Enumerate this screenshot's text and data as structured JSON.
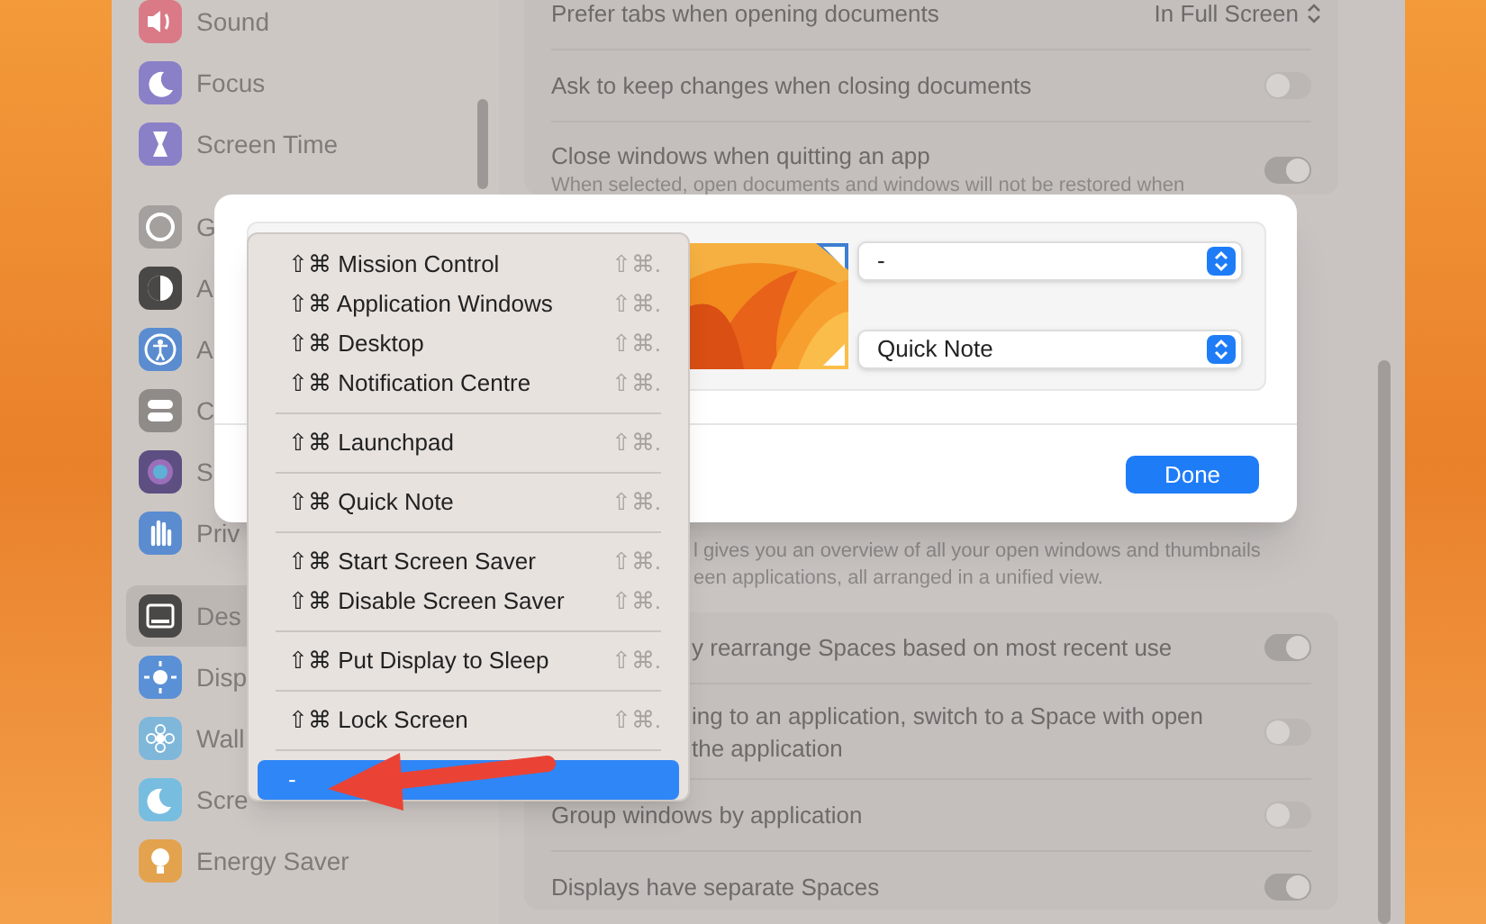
{
  "sidebar": {
    "items": [
      {
        "label": "Sound",
        "selected": false
      },
      {
        "label": "Focus",
        "selected": false
      },
      {
        "label": "Screen Time",
        "selected": false
      },
      {
        "label": "G",
        "selected": false
      },
      {
        "label": "A",
        "selected": false
      },
      {
        "label": "A",
        "selected": false
      },
      {
        "label": "C",
        "selected": false
      },
      {
        "label": "S",
        "selected": false
      },
      {
        "label": "Priv",
        "selected": false
      },
      {
        "label": "Des",
        "selected": true
      },
      {
        "label": "Disp",
        "selected": false
      },
      {
        "label": "Wall",
        "selected": false
      },
      {
        "label": "Scre",
        "selected": false
      },
      {
        "label": "Energy Saver",
        "selected": false
      }
    ]
  },
  "settings": {
    "top_rows": [
      {
        "kind": "popup",
        "label": "Prefer tabs when opening documents",
        "value": "In Full Screen"
      },
      {
        "kind": "toggle",
        "label": "Ask to keep changes when closing documents",
        "on": false
      },
      {
        "kind": "toggle",
        "label": "Close windows when quitting an app",
        "description": "When selected, open documents and windows will not be restored when",
        "on": true
      }
    ],
    "mission_control_description": [
      "l gives you an overview of all your open windows and thumbnails",
      "een applications, all arranged in a unified view."
    ],
    "bottom_rows": [
      {
        "kind": "toggle",
        "label": "y rearrange Spaces based on most recent use",
        "on": true
      },
      {
        "kind": "toggle",
        "label": "ing to an application, switch to a Space with open",
        "description": "the application",
        "on": false
      },
      {
        "kind": "toggle",
        "label": "Group windows by application",
        "on": false
      },
      {
        "kind": "toggle",
        "label": "Displays have separate Spaces",
        "on": true
      }
    ]
  },
  "dialog": {
    "dropdowns": [
      {
        "value": "-"
      },
      {
        "value": "Quick Note"
      }
    ],
    "done_button": "Done"
  },
  "menu": {
    "sections": [
      [
        {
          "label": "⇧⌘ Mission Control",
          "shortcut": "⇧⌘.",
          "selected": false
        },
        {
          "label": "⇧⌘ Application Windows",
          "shortcut": "⇧⌘.",
          "selected": false
        },
        {
          "label": "⇧⌘ Desktop",
          "shortcut": "⇧⌘.",
          "selected": false
        },
        {
          "label": "⇧⌘ Notification Centre",
          "shortcut": "⇧⌘.",
          "selected": false
        }
      ],
      [
        {
          "label": "⇧⌘ Launchpad",
          "shortcut": "⇧⌘.",
          "selected": false
        }
      ],
      [
        {
          "label": "⇧⌘ Quick Note",
          "shortcut": "⇧⌘.",
          "selected": false
        }
      ],
      [
        {
          "label": "⇧⌘ Start Screen Saver",
          "shortcut": "⇧⌘.",
          "selected": false
        },
        {
          "label": "⇧⌘ Disable Screen Saver",
          "shortcut": "⇧⌘.",
          "selected": false
        }
      ],
      [
        {
          "label": "⇧⌘ Put Display to Sleep",
          "shortcut": "⇧⌘.",
          "selected": false
        }
      ],
      [
        {
          "label": "⇧⌘ Lock Screen",
          "shortcut": "⇧⌘.",
          "selected": false
        }
      ],
      [
        {
          "label": "-",
          "selected": true
        }
      ]
    ]
  }
}
